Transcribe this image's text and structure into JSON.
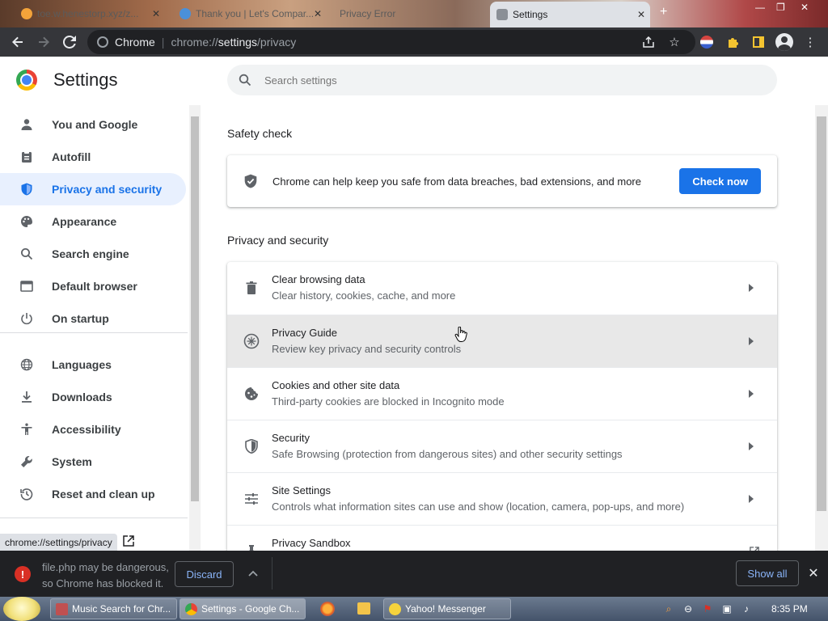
{
  "tabs": [
    {
      "title": "toe.w.henestorp.xyz/z..."
    },
    {
      "title": "Thank you | Let's Compar..."
    },
    {
      "title": "Privacy Error"
    },
    {
      "title": "Settings"
    }
  ],
  "toolbar": {
    "chip": "Chrome",
    "url_scheme": "chrome://",
    "url_host": "settings",
    "url_path": "/privacy"
  },
  "settings": {
    "title": "Settings",
    "search_placeholder": "Search settings"
  },
  "sidebar": {
    "items": [
      {
        "label": "You and Google",
        "icon": "person-icon"
      },
      {
        "label": "Autofill",
        "icon": "clipboard-icon"
      },
      {
        "label": "Privacy and security",
        "icon": "shield-icon"
      },
      {
        "label": "Appearance",
        "icon": "palette-icon"
      },
      {
        "label": "Search engine",
        "icon": "search-icon"
      },
      {
        "label": "Default browser",
        "icon": "browser-icon"
      },
      {
        "label": "On startup",
        "icon": "power-icon"
      },
      {
        "label": "Languages",
        "icon": "globe-icon"
      },
      {
        "label": "Downloads",
        "icon": "download-icon"
      },
      {
        "label": "Accessibility",
        "icon": "accessibility-icon"
      },
      {
        "label": "System",
        "icon": "wrench-icon"
      },
      {
        "label": "Reset and clean up",
        "icon": "history-icon"
      }
    ]
  },
  "safety_check": {
    "heading": "Safety check",
    "message": "Chrome can help keep you safe from data breaches, bad extensions, and more",
    "button": "Check now"
  },
  "privacy": {
    "heading": "Privacy and security",
    "rows": [
      {
        "title": "Clear browsing data",
        "subtitle": "Clear history, cookies, cache, and more",
        "icon": "trash-icon"
      },
      {
        "title": "Privacy Guide",
        "subtitle": "Review key privacy and security controls",
        "icon": "compass-icon"
      },
      {
        "title": "Cookies and other site data",
        "subtitle": "Third-party cookies are blocked in Incognito mode",
        "icon": "cookie-icon"
      },
      {
        "title": "Security",
        "subtitle": "Safe Browsing (protection from dangerous sites) and other security settings",
        "icon": "shield-icon"
      },
      {
        "title": "Site Settings",
        "subtitle": "Controls what information sites can use and show (location, camera, pop-ups, and more)",
        "icon": "sliders-icon"
      },
      {
        "title": "Privacy Sandbox",
        "subtitle": "",
        "icon": "flask-icon"
      }
    ]
  },
  "status_url": "chrome://settings/privacy",
  "download_bar": {
    "line1": "file.php may be dangerous,",
    "line2": "so Chrome has blocked it.",
    "discard": "Discard",
    "show_all": "Show all"
  },
  "taskbar": {
    "tasks": [
      {
        "label": "Music Search for Chr..."
      },
      {
        "label": "Settings - Google Ch..."
      },
      {
        "label": "Yahoo! Messenger"
      }
    ],
    "clock": "8:35 PM"
  },
  "colors": {
    "accent": "#1a73e8",
    "active_nav_bg": "#e8f0fe",
    "download_bar_bg": "#202124",
    "danger": "#d93025"
  }
}
